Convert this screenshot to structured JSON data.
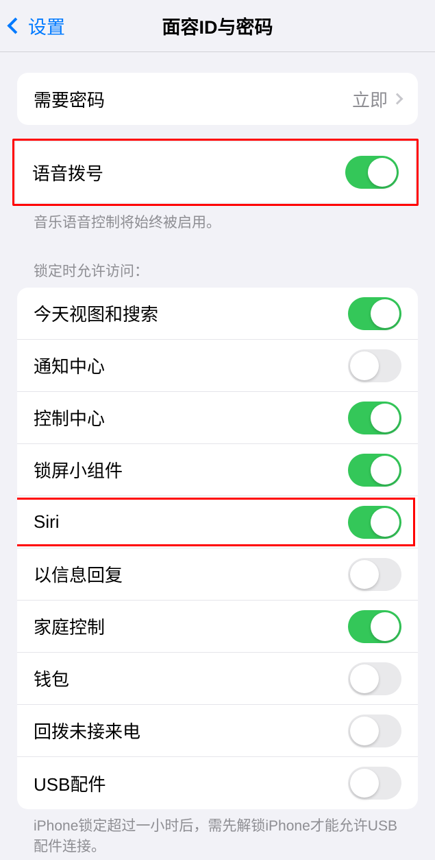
{
  "header": {
    "back_label": "设置",
    "title": "面容ID与密码"
  },
  "passcode": {
    "label": "需要密码",
    "value": "立即"
  },
  "voice_dial": {
    "label": "语音拨号",
    "enabled": true,
    "footer": "音乐语音控制将始终被启用。"
  },
  "locked_access": {
    "header": "锁定时允许访问：",
    "items": [
      {
        "label": "今天视图和搜索",
        "enabled": true
      },
      {
        "label": "通知中心",
        "enabled": false
      },
      {
        "label": "控制中心",
        "enabled": true
      },
      {
        "label": "锁屏小组件",
        "enabled": true
      },
      {
        "label": "Siri",
        "enabled": true,
        "highlighted": true
      },
      {
        "label": "以信息回复",
        "enabled": false
      },
      {
        "label": "家庭控制",
        "enabled": true
      },
      {
        "label": "钱包",
        "enabled": false
      },
      {
        "label": "回拨未接来电",
        "enabled": false
      },
      {
        "label": "USB配件",
        "enabled": false
      }
    ],
    "footer": "iPhone锁定超过一小时后，需先解锁iPhone才能允许USB配件连接。"
  }
}
